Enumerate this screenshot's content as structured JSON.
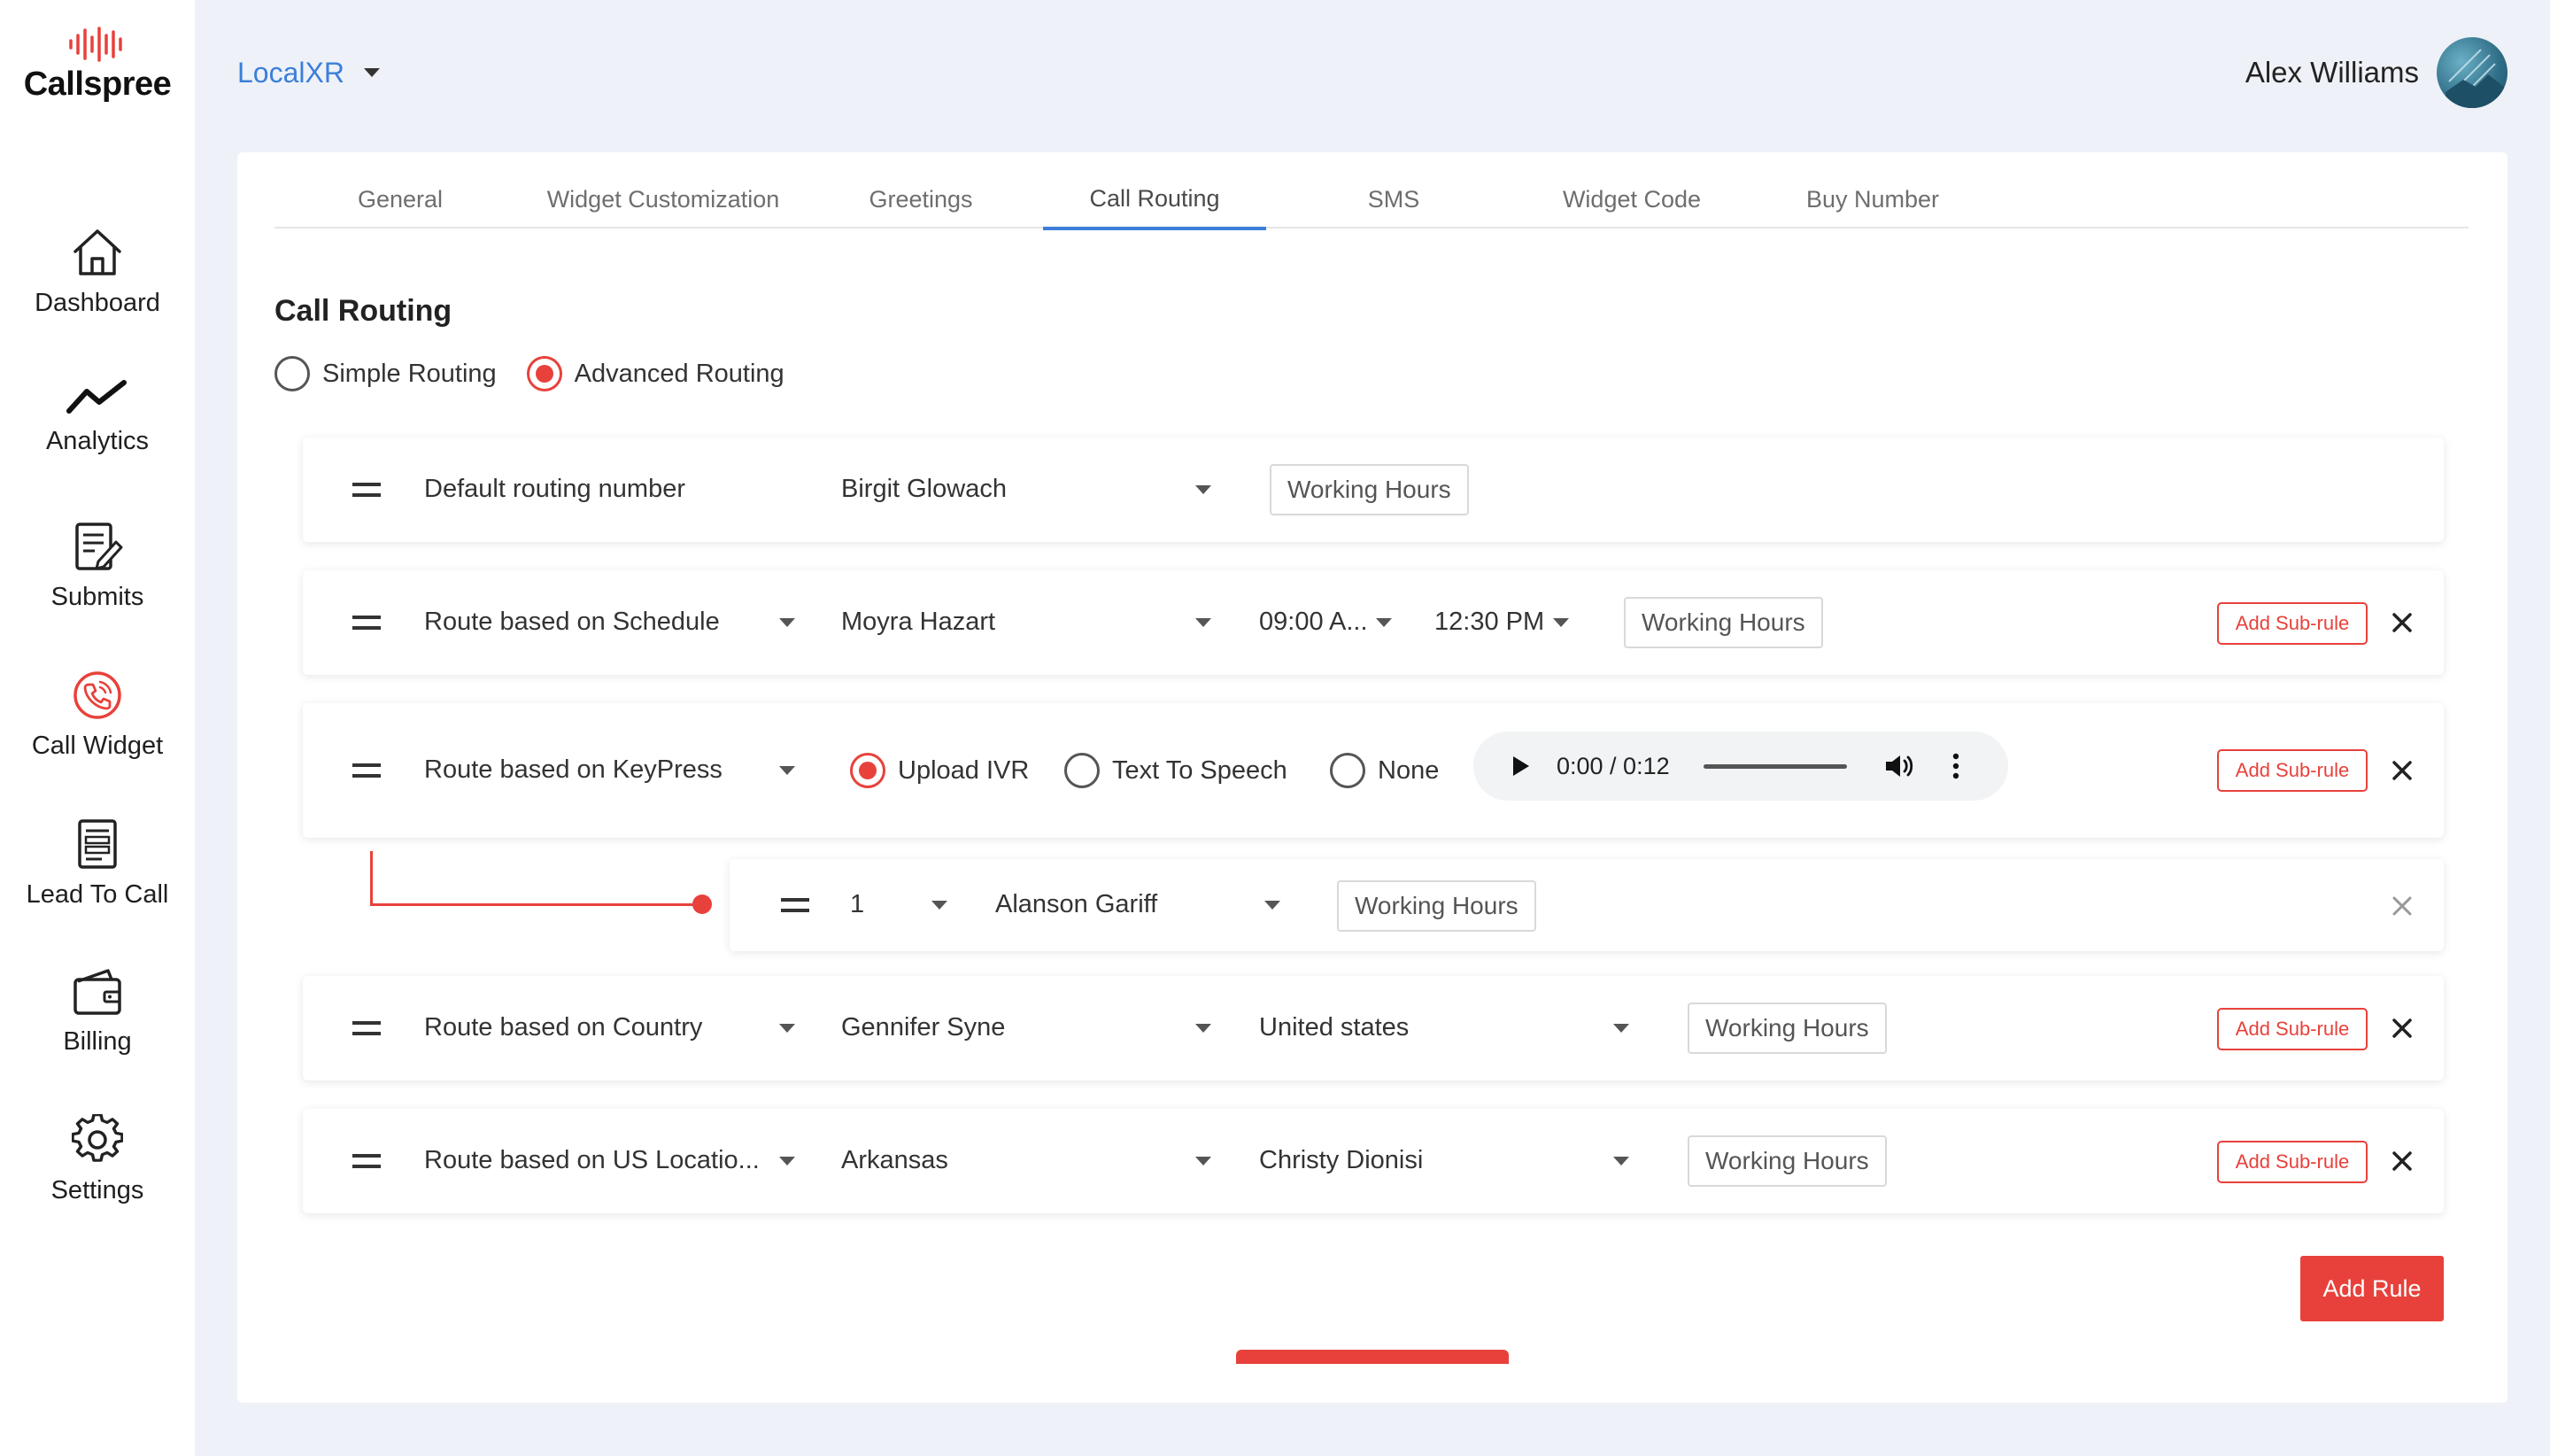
{
  "brand": {
    "name": "Callspree",
    "accent": "#e8413b",
    "link": "#3b7fd9"
  },
  "sidebar": {
    "items": [
      {
        "label": "Dashboard",
        "icon": "home-icon"
      },
      {
        "label": "Analytics",
        "icon": "trend-icon"
      },
      {
        "label": "Submits",
        "icon": "clipboard-edit-icon"
      },
      {
        "label": "Call Widget",
        "icon": "phone-circle-icon"
      },
      {
        "label": "Lead To Call",
        "icon": "form-icon"
      },
      {
        "label": "Billing",
        "icon": "wallet-icon"
      },
      {
        "label": "Settings",
        "icon": "gear-icon"
      }
    ]
  },
  "header": {
    "project": "LocalXR",
    "user_name": "Alex Williams"
  },
  "tabs": [
    "General",
    "Widget Customization",
    "Greetings",
    "Call Routing",
    "SMS",
    "Widget Code",
    "Buy Number"
  ],
  "active_tab": "Call Routing",
  "routing": {
    "title": "Call Routing",
    "modes": [
      "Simple Routing",
      "Advanced Routing"
    ],
    "selected_mode": "Advanced Routing"
  },
  "rules": {
    "default": {
      "label": "Default routing number",
      "agent": "Birgit Glowach",
      "hours": "Working Hours"
    },
    "schedule": {
      "label": "Route based on Schedule",
      "agent": "Moyra Hazart",
      "from": "09:00 A...",
      "to": "12:30 PM",
      "hours": "Working Hours",
      "subrule": "Add Sub-rule"
    },
    "keypress": {
      "label": "Route based on KeyPress",
      "options": [
        "Upload IVR",
        "Text To Speech",
        "None"
      ],
      "selected": "Upload IVR",
      "audio_time": "0:00 / 0:12",
      "subrule": "Add Sub-rule"
    },
    "keypress_sub": {
      "key": "1",
      "agent": "Alanson Gariff",
      "hours": "Working Hours"
    },
    "country": {
      "label": "Route based on Country",
      "agent": "Gennifer Syne",
      "country": "United states",
      "hours": "Working Hours",
      "subrule": "Add Sub-rule"
    },
    "us_location": {
      "label": "Route based on US Locatio...",
      "state": "Arkansas",
      "agent": "Christy Dionisi",
      "hours": "Working Hours",
      "subrule": "Add Sub-rule"
    }
  },
  "actions": {
    "add_rule": "Add Rule"
  }
}
